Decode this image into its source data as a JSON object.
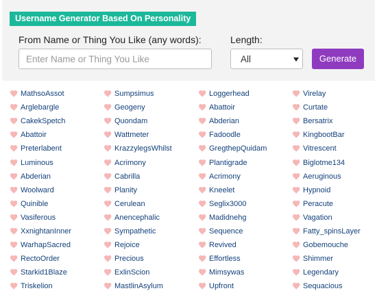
{
  "header": {
    "title": "Username Generator Based On Personality"
  },
  "form": {
    "name_label": "From Name or Thing You Like (any words):",
    "name_placeholder": "Enter Name or Thing You Like",
    "name_value": "",
    "length_label": "Length:",
    "length_selected": "All",
    "generate_label": "Generate"
  },
  "colors": {
    "badge": "#1cb89a",
    "button": "#8f3bbf",
    "heart": "#f6b7b7",
    "link": "#13407a",
    "panel": "#f3f3f3"
  },
  "icons": {
    "item": "heart-icon",
    "select": "chevron-down-icon"
  },
  "results": {
    "columns": [
      [
        "MathsoAssot",
        "Arglebargle",
        "CakekSpetch",
        "Abattoir",
        "Preterlabent",
        "Luminous",
        "Abderian",
        "Woolward",
        "Quinible",
        "Vasiferous",
        "XxnightanInner",
        "WarhapSacred",
        "RectoOrder",
        "Starkid1Blaze",
        "Triskelion"
      ],
      [
        "Sumpsimus",
        "Geogeny",
        "Quondam",
        "Wattmeter",
        "KrazzylegsWhilst",
        "Acrimony",
        "Cabrilla",
        "Planity",
        "Cerulean",
        "Anencephalic",
        "Sympathetic",
        "Rejoice",
        "Precious",
        "ExlinScion",
        "MastlinAsylum"
      ],
      [
        "Loggerhead",
        "Abattoir",
        "Abderian",
        "Fadoodle",
        "GregthepQuidam",
        "Plantigrade",
        "Acrimony",
        "Kneelet",
        "Seglix3000",
        "Madidnehg",
        "Sequence",
        "Revived",
        "Effortless",
        "Mimsywas",
        "Upfront"
      ],
      [
        "Virelay",
        "Curtate",
        "Bersatrix",
        "KingbootBar",
        "Vitrescent",
        "Biglotme134",
        "Aeruginous",
        "Hypnoid",
        "Peracute",
        "Vagation",
        "Fatty_spinsLayer",
        "Gobemouche",
        "Shimmer",
        "Legendary",
        "Sequacious"
      ]
    ]
  }
}
